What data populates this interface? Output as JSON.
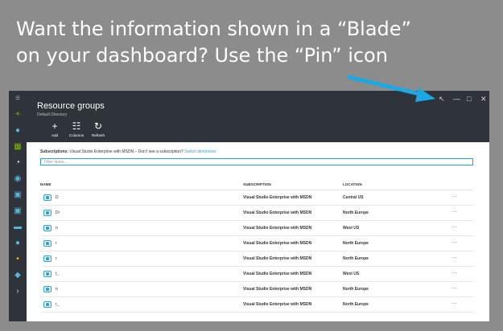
{
  "headline": {
    "line1": "Want the information shown in a “Blade”",
    "line2": "on your dashboard?  Use the “Pin” icon"
  },
  "window": {
    "pin_icon": "pin-icon",
    "minimize_icon": "minimize-icon",
    "maximize_icon": "maximize-icon",
    "close_icon": "close-icon",
    "pin_glyph": "↖",
    "minimize_glyph": "—",
    "maximize_glyph": "□",
    "close_glyph": "✕"
  },
  "blade": {
    "title": "Resource groups",
    "subtitle": "Default Directory"
  },
  "commands": [
    {
      "label": "Add",
      "glyph": "+",
      "icon": "add-icon"
    },
    {
      "label": "Columns",
      "glyph": "☷",
      "icon": "columns-icon"
    },
    {
      "label": "Refresh",
      "glyph": "↻",
      "icon": "refresh-icon"
    }
  ],
  "subscriptions": {
    "label": "Subscriptions:",
    "value": "Visual Studio Enterprise with MSDN – Don’t see a subscription?",
    "link": "Switch directories"
  },
  "filter": {
    "placeholder": "Filter items..."
  },
  "columns": {
    "name": "NAME",
    "subscription": "SUBSCRIPTION",
    "location": "LOCATION"
  },
  "rows": [
    {
      "name": "D",
      "subscription": "Visual Studio Enterprise with MSDN",
      "location": "Central US",
      "more": "..."
    },
    {
      "name": "Di",
      "subscription": "Visual Studio Enterprise with MSDN",
      "location": "North Europe",
      "more": "..."
    },
    {
      "name": "n",
      "subscription": "Visual Studio Enterprise with MSDN",
      "location": "West US",
      "more": "..."
    },
    {
      "name": "r",
      "subscription": "Visual Studio Enterprise with MSDN",
      "location": "North Europe",
      "more": "..."
    },
    {
      "name": "r",
      "subscription": "Visual Studio Enterprise with MSDN",
      "location": "North Europe",
      "more": "..."
    },
    {
      "name": "t_",
      "subscription": "Visual Studio Enterprise with MSDN",
      "location": "West US",
      "more": "..."
    },
    {
      "name": "n",
      "subscription": "Visual Studio Enterprise with MSDN",
      "location": "North Europe",
      "more": "..."
    },
    {
      "name": "r_",
      "subscription": "Visual Studio Enterprise with MSDN",
      "location": "North Europe",
      "more": "..."
    }
  ],
  "nav": [
    {
      "icon": "hamburger-icon",
      "glyph": "≡",
      "color": "#9aa0a6"
    },
    {
      "icon": "new-plus-icon",
      "glyph": "+",
      "color": "#7fba00"
    },
    {
      "icon": "cloud-icon",
      "glyph": "●",
      "color": "#59b4d9"
    },
    {
      "icon": "all-resources-icon",
      "glyph": "▦",
      "color": "#7fba00"
    },
    {
      "icon": "recent-clock-icon",
      "glyph": "◔",
      "color": "#ffffff"
    },
    {
      "icon": "globe-icon",
      "glyph": "◉",
      "color": "#59b4d9"
    },
    {
      "icon": "monitor-icon",
      "glyph": "▣",
      "color": "#59b4d9"
    },
    {
      "icon": "vm-icon",
      "glyph": "▣",
      "color": "#59b4d9"
    },
    {
      "icon": "storage-icon",
      "glyph": "▬",
      "color": "#59b4d9"
    },
    {
      "icon": "cloud-service-icon",
      "glyph": "●",
      "color": "#59b4d9"
    },
    {
      "icon": "key-icon",
      "glyph": "•",
      "color": "#ffb900"
    },
    {
      "icon": "diamond-icon",
      "glyph": "◆",
      "color": "#59b4d9"
    },
    {
      "icon": "expand-chevron-icon",
      "glyph": "›",
      "color": "#c8c8c8"
    }
  ],
  "colors": {
    "background": "#8c8c8c",
    "portal_dark": "#2f343a",
    "accent": "#2ca2d9",
    "arrow": "#1ca8e3"
  }
}
